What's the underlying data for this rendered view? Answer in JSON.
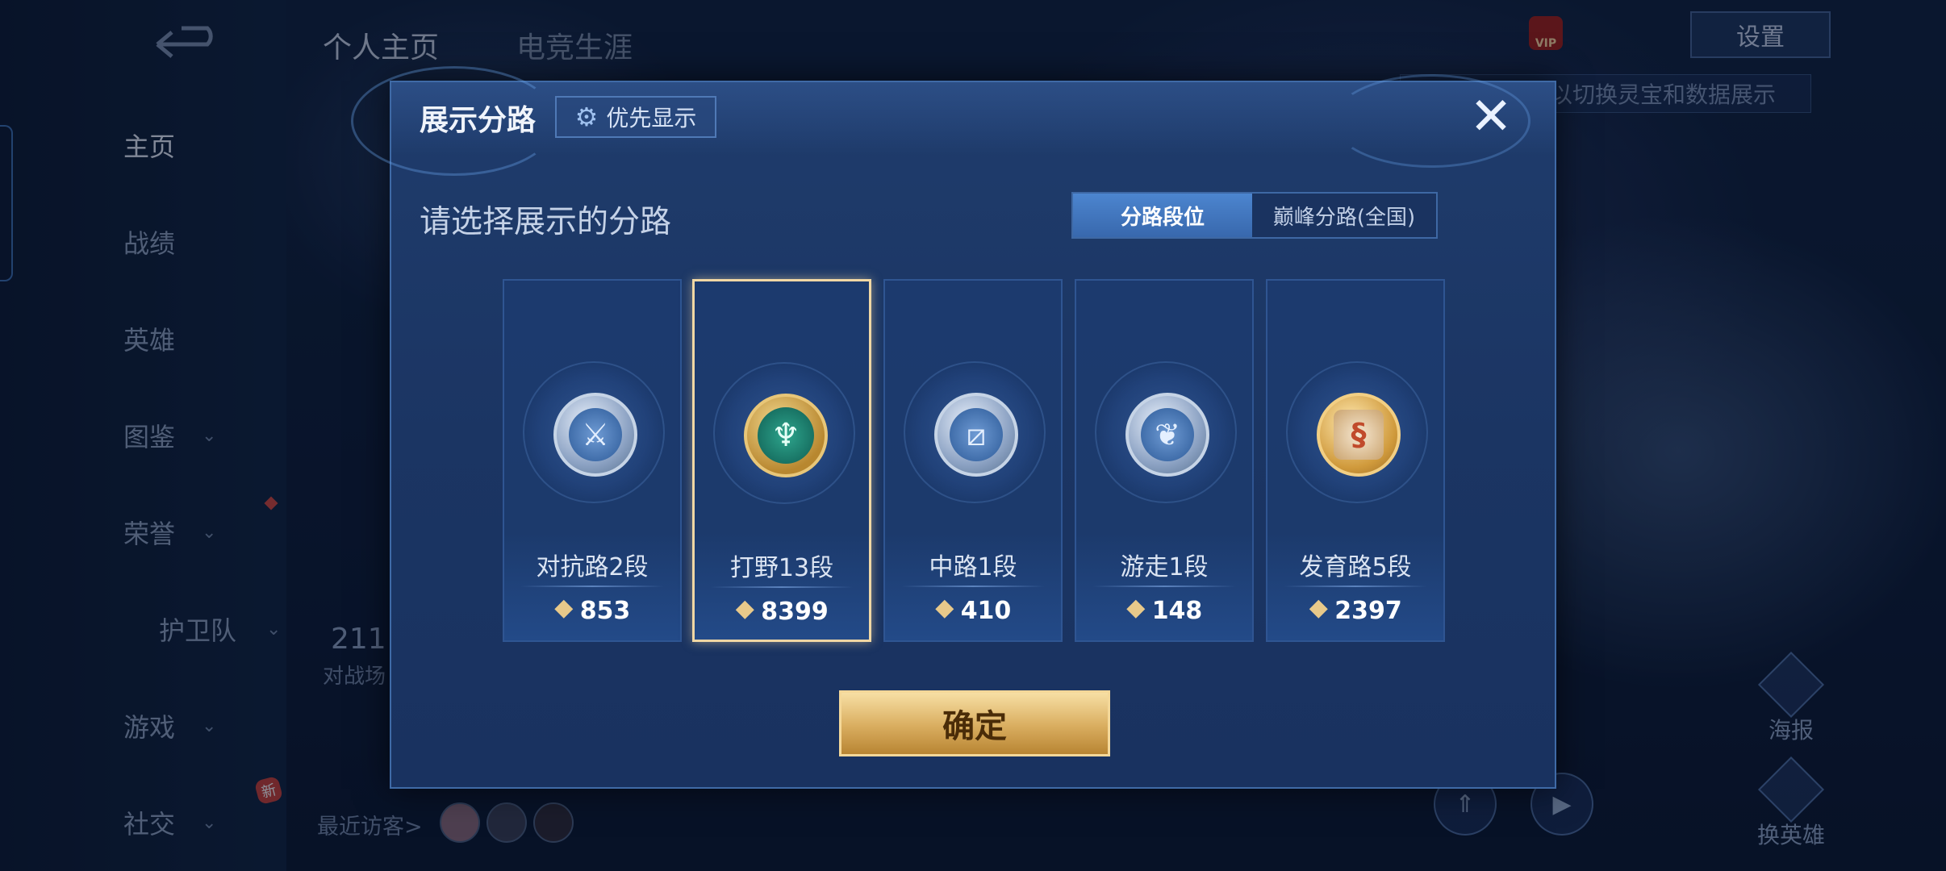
{
  "sidebar": {
    "items": [
      {
        "label": "主页",
        "chevron": false
      },
      {
        "label": "战绩",
        "chevron": false
      },
      {
        "label": "英雄",
        "chevron": false
      },
      {
        "label": "图鉴",
        "chevron": true
      },
      {
        "label": "荣誉",
        "chevron": true
      },
      {
        "label": "护卫队",
        "chevron": true
      },
      {
        "label": "游戏",
        "chevron": true
      },
      {
        "label": "社交",
        "chevron": true
      }
    ],
    "new_badge": "新"
  },
  "top_tabs": [
    "个人主页",
    "电竞生涯"
  ],
  "top_right": {
    "settings_label": "设置",
    "vip_label": "VIP",
    "hint": "以切换灵宝和数据展示"
  },
  "right_buttons": {
    "poster": "海报",
    "switch_hero": "换英雄"
  },
  "profile": {
    "stat_value": "211",
    "stat_label": "对战场",
    "visitors_label": "最近访客>"
  },
  "modal": {
    "title": "展示分路",
    "priority_label": "优先显示",
    "subtitle": "请选择展示的分路",
    "tabs": [
      {
        "label": "分路段位",
        "active": true
      },
      {
        "label": "巅峰分路(全国)",
        "active": false
      }
    ],
    "cards": [
      {
        "rank": "对抗路2段",
        "score": "853",
        "icon": "sword-shield-icon",
        "selected": false
      },
      {
        "rank": "打野13段",
        "score": "8399",
        "icon": "jungle-dragon-icon",
        "selected": true
      },
      {
        "rank": "中路1段",
        "score": "410",
        "icon": "mid-lane-icon",
        "selected": false
      },
      {
        "rank": "游走1段",
        "score": "148",
        "icon": "wings-icon",
        "selected": false
      },
      {
        "rank": "发育路5段",
        "score": "2397",
        "icon": "bottom-lane-icon",
        "selected": false
      }
    ],
    "confirm_label": "确定"
  }
}
